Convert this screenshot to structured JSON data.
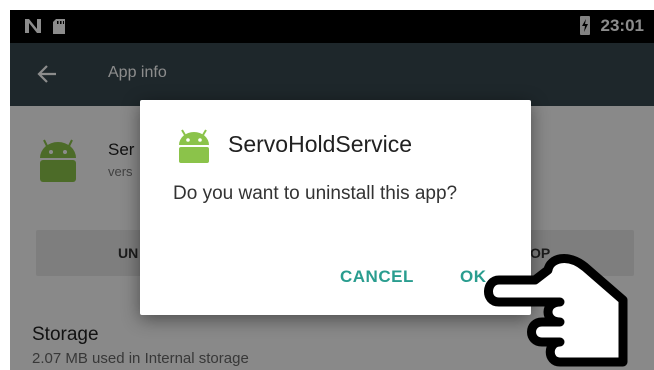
{
  "status_bar": {
    "time": "23:01",
    "left_icons": [
      "n-icon",
      "sd-card-icon"
    ],
    "right_icons": [
      "battery-icon"
    ]
  },
  "toolbar": {
    "title": "App info",
    "back_icon": "arrow-back-icon"
  },
  "background": {
    "app_name": "Ser",
    "app_version": "vers",
    "uninstall_label": "UN",
    "stop_label": "OP",
    "storage_title": "Storage",
    "storage_detail": "2.07 MB used in Internal storage"
  },
  "dialog": {
    "title": "ServoHoldService",
    "message": "Do you want to uninstall this app?",
    "cancel_label": "CANCEL",
    "ok_label": "OK"
  },
  "colors": {
    "toolbar": "#37474f",
    "accent": "#2a9d8f",
    "android_green": "#8bc34a"
  }
}
